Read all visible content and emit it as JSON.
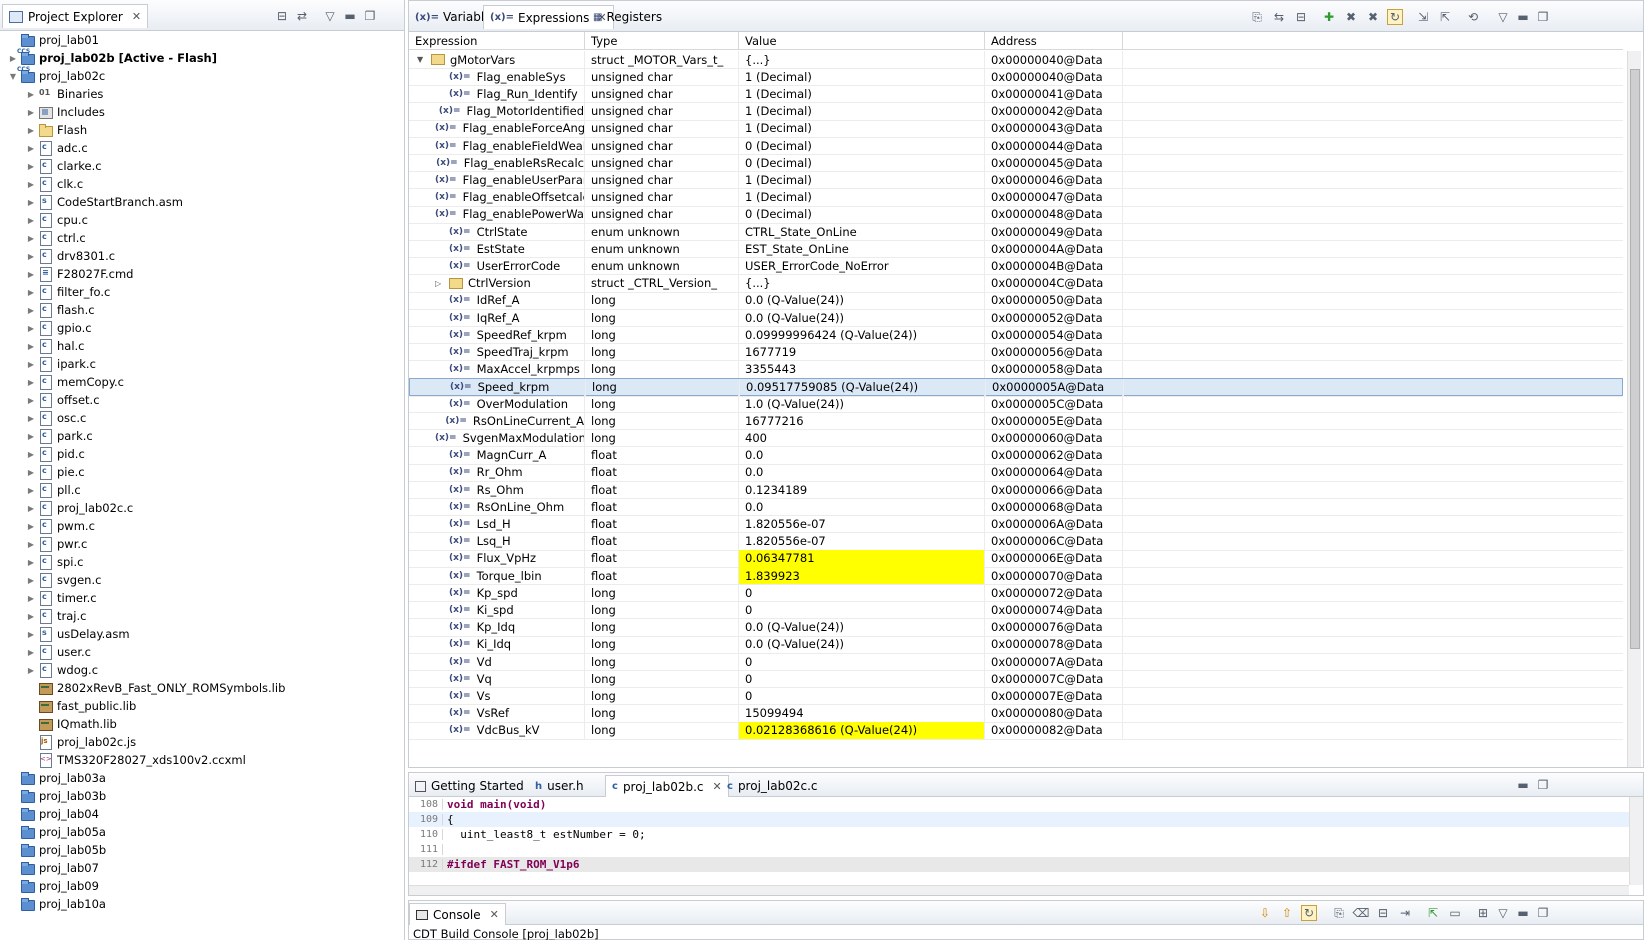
{
  "explorer": {
    "title": "Project Explorer",
    "items": [
      {
        "label": "proj_lab01",
        "kind": "project",
        "indent": 0,
        "arrow": ""
      },
      {
        "label": "proj_lab02b  [Active - Flash]",
        "kind": "ccs-project",
        "indent": 0,
        "arrow": "▶",
        "bold": true
      },
      {
        "label": "proj_lab02c",
        "kind": "ccs-project",
        "indent": 0,
        "arrow": "▼"
      },
      {
        "label": "Binaries",
        "kind": "bin",
        "indent": 1,
        "arrow": "▶"
      },
      {
        "label": "Includes",
        "kind": "inc",
        "indent": 1,
        "arrow": "▶"
      },
      {
        "label": "Flash",
        "kind": "folder",
        "indent": 1,
        "arrow": "▶"
      },
      {
        "label": "adc.c",
        "kind": "file",
        "indent": 1,
        "arrow": "▶"
      },
      {
        "label": "clarke.c",
        "kind": "file",
        "indent": 1,
        "arrow": "▶"
      },
      {
        "label": "clk.c",
        "kind": "file",
        "indent": 1,
        "arrow": "▶"
      },
      {
        "label": "CodeStartBranch.asm",
        "kind": "asm",
        "indent": 1,
        "arrow": "▶"
      },
      {
        "label": "cpu.c",
        "kind": "file",
        "indent": 1,
        "arrow": "▶"
      },
      {
        "label": "ctrl.c",
        "kind": "file",
        "indent": 1,
        "arrow": "▶"
      },
      {
        "label": "drv8301.c",
        "kind": "file",
        "indent": 1,
        "arrow": "▶"
      },
      {
        "label": "F28027F.cmd",
        "kind": "cmd",
        "indent": 1,
        "arrow": "▶"
      },
      {
        "label": "filter_fo.c",
        "kind": "file",
        "indent": 1,
        "arrow": "▶"
      },
      {
        "label": "flash.c",
        "kind": "file",
        "indent": 1,
        "arrow": "▶"
      },
      {
        "label": "gpio.c",
        "kind": "file",
        "indent": 1,
        "arrow": "▶"
      },
      {
        "label": "hal.c",
        "kind": "file",
        "indent": 1,
        "arrow": "▶"
      },
      {
        "label": "ipark.c",
        "kind": "file",
        "indent": 1,
        "arrow": "▶"
      },
      {
        "label": "memCopy.c",
        "kind": "file",
        "indent": 1,
        "arrow": "▶"
      },
      {
        "label": "offset.c",
        "kind": "file",
        "indent": 1,
        "arrow": "▶"
      },
      {
        "label": "osc.c",
        "kind": "file",
        "indent": 1,
        "arrow": "▶"
      },
      {
        "label": "park.c",
        "kind": "file",
        "indent": 1,
        "arrow": "▶"
      },
      {
        "label": "pid.c",
        "kind": "file",
        "indent": 1,
        "arrow": "▶"
      },
      {
        "label": "pie.c",
        "kind": "file",
        "indent": 1,
        "arrow": "▶"
      },
      {
        "label": "pll.c",
        "kind": "file",
        "indent": 1,
        "arrow": "▶"
      },
      {
        "label": "proj_lab02c.c",
        "kind": "file",
        "indent": 1,
        "arrow": "▶"
      },
      {
        "label": "pwm.c",
        "kind": "file",
        "indent": 1,
        "arrow": "▶"
      },
      {
        "label": "pwr.c",
        "kind": "file",
        "indent": 1,
        "arrow": "▶"
      },
      {
        "label": "spi.c",
        "kind": "file",
        "indent": 1,
        "arrow": "▶"
      },
      {
        "label": "svgen.c",
        "kind": "file",
        "indent": 1,
        "arrow": "▶"
      },
      {
        "label": "timer.c",
        "kind": "file",
        "indent": 1,
        "arrow": "▶"
      },
      {
        "label": "traj.c",
        "kind": "file",
        "indent": 1,
        "arrow": "▶"
      },
      {
        "label": "usDelay.asm",
        "kind": "asm",
        "indent": 1,
        "arrow": "▶"
      },
      {
        "label": "user.c",
        "kind": "file",
        "indent": 1,
        "arrow": "▶"
      },
      {
        "label": "wdog.c",
        "kind": "file",
        "indent": 1,
        "arrow": "▶"
      },
      {
        "label": "2802xRevB_Fast_ONLY_ROMSymbols.lib",
        "kind": "lib",
        "indent": 1,
        "arrow": ""
      },
      {
        "label": "fast_public.lib",
        "kind": "lib",
        "indent": 1,
        "arrow": ""
      },
      {
        "label": "IQmath.lib",
        "kind": "lib",
        "indent": 1,
        "arrow": ""
      },
      {
        "label": "proj_lab02c.js",
        "kind": "js",
        "indent": 1,
        "arrow": ""
      },
      {
        "label": "TMS320F28027_xds100v2.ccxml",
        "kind": "xml",
        "indent": 1,
        "arrow": ""
      },
      {
        "label": "proj_lab03a",
        "kind": "project",
        "indent": 0,
        "arrow": ""
      },
      {
        "label": "proj_lab03b",
        "kind": "project",
        "indent": 0,
        "arrow": ""
      },
      {
        "label": "proj_lab04",
        "kind": "project",
        "indent": 0,
        "arrow": ""
      },
      {
        "label": "proj_lab05a",
        "kind": "project",
        "indent": 0,
        "arrow": ""
      },
      {
        "label": "proj_lab05b",
        "kind": "project",
        "indent": 0,
        "arrow": ""
      },
      {
        "label": "proj_lab07",
        "kind": "project",
        "indent": 0,
        "arrow": ""
      },
      {
        "label": "proj_lab09",
        "kind": "project",
        "indent": 0,
        "arrow": ""
      },
      {
        "label": "proj_lab10a",
        "kind": "project",
        "indent": 0,
        "arrow": ""
      }
    ]
  },
  "expressions": {
    "tabs": [
      {
        "label": "Variables",
        "icon": "(x)="
      },
      {
        "label": "Expressions",
        "icon": "(x)="
      },
      {
        "label": "Registers",
        "icon": "▦"
      }
    ],
    "columns": [
      "Expression",
      "Type",
      "Value",
      "Address"
    ],
    "rows": [
      {
        "name": "gMotorVars",
        "type": "struct _MOTOR_Vars_t_",
        "value": "{...}",
        "address": "0x00000040@Data",
        "level": 0,
        "icon": "struct",
        "arrow": "▼"
      },
      {
        "name": "Flag_enableSys",
        "type": "unsigned char",
        "value": "1 (Decimal)",
        "address": "0x00000040@Data",
        "level": 1,
        "icon": "var"
      },
      {
        "name": "Flag_Run_Identify",
        "type": "unsigned char",
        "value": "1 (Decimal)",
        "address": "0x00000041@Data",
        "level": 1,
        "icon": "var"
      },
      {
        "name": "Flag_MotorIdentified",
        "type": "unsigned char",
        "value": "1 (Decimal)",
        "address": "0x00000042@Data",
        "level": 1,
        "icon": "var"
      },
      {
        "name": "Flag_enableForceAng",
        "type": "unsigned char",
        "value": "1 (Decimal)",
        "address": "0x00000043@Data",
        "level": 1,
        "icon": "var"
      },
      {
        "name": "Flag_enableFieldWeak",
        "type": "unsigned char",
        "value": "0 (Decimal)",
        "address": "0x00000044@Data",
        "level": 1,
        "icon": "var"
      },
      {
        "name": "Flag_enableRsRecalc",
        "type": "unsigned char",
        "value": "0 (Decimal)",
        "address": "0x00000045@Data",
        "level": 1,
        "icon": "var"
      },
      {
        "name": "Flag_enableUserParam",
        "type": "unsigned char",
        "value": "1 (Decimal)",
        "address": "0x00000046@Data",
        "level": 1,
        "icon": "var"
      },
      {
        "name": "Flag_enableOffsetcalc",
        "type": "unsigned char",
        "value": "1 (Decimal)",
        "address": "0x00000047@Data",
        "level": 1,
        "icon": "var"
      },
      {
        "name": "Flag_enablePowerWar",
        "type": "unsigned char",
        "value": "0 (Decimal)",
        "address": "0x00000048@Data",
        "level": 1,
        "icon": "var"
      },
      {
        "name": "CtrlState",
        "type": "enum unknown",
        "value": "CTRL_State_OnLine",
        "address": "0x00000049@Data",
        "level": 1,
        "icon": "var"
      },
      {
        "name": "EstState",
        "type": "enum unknown",
        "value": "EST_State_OnLine",
        "address": "0x0000004A@Data",
        "level": 1,
        "icon": "var"
      },
      {
        "name": "UserErrorCode",
        "type": "enum unknown",
        "value": "USER_ErrorCode_NoError",
        "address": "0x0000004B@Data",
        "level": 1,
        "icon": "var"
      },
      {
        "name": "CtrlVersion",
        "type": "struct _CTRL_Version_",
        "value": "{...}",
        "address": "0x0000004C@Data",
        "level": 1,
        "icon": "struct",
        "arrow": "▷"
      },
      {
        "name": "IdRef_A",
        "type": "long",
        "value": "0.0 (Q-Value(24))",
        "address": "0x00000050@Data",
        "level": 1,
        "icon": "var"
      },
      {
        "name": "IqRef_A",
        "type": "long",
        "value": "0.0 (Q-Value(24))",
        "address": "0x00000052@Data",
        "level": 1,
        "icon": "var"
      },
      {
        "name": "SpeedRef_krpm",
        "type": "long",
        "value": "0.09999996424 (Q-Value(24))",
        "address": "0x00000054@Data",
        "level": 1,
        "icon": "var"
      },
      {
        "name": "SpeedTraj_krpm",
        "type": "long",
        "value": "1677719",
        "address": "0x00000056@Data",
        "level": 1,
        "icon": "var"
      },
      {
        "name": "MaxAccel_krpmps",
        "type": "long",
        "value": "3355443",
        "address": "0x00000058@Data",
        "level": 1,
        "icon": "var"
      },
      {
        "name": "Speed_krpm",
        "type": "long",
        "value": "0.09517759085 (Q-Value(24))",
        "address": "0x0000005A@Data",
        "level": 1,
        "icon": "var",
        "selected": true
      },
      {
        "name": "OverModulation",
        "type": "long",
        "value": "1.0 (Q-Value(24))",
        "address": "0x0000005C@Data",
        "level": 1,
        "icon": "var"
      },
      {
        "name": "RsOnLineCurrent_A",
        "type": "long",
        "value": "16777216",
        "address": "0x0000005E@Data",
        "level": 1,
        "icon": "var"
      },
      {
        "name": "SvgenMaxModulation",
        "type": "long",
        "value": "400",
        "address": "0x00000060@Data",
        "level": 1,
        "icon": "var"
      },
      {
        "name": "MagnCurr_A",
        "type": "float",
        "value": "0.0",
        "address": "0x00000062@Data",
        "level": 1,
        "icon": "var"
      },
      {
        "name": "Rr_Ohm",
        "type": "float",
        "value": "0.0",
        "address": "0x00000064@Data",
        "level": 1,
        "icon": "var"
      },
      {
        "name": "Rs_Ohm",
        "type": "float",
        "value": "0.1234189",
        "address": "0x00000066@Data",
        "level": 1,
        "icon": "var"
      },
      {
        "name": "RsOnLine_Ohm",
        "type": "float",
        "value": "0.0",
        "address": "0x00000068@Data",
        "level": 1,
        "icon": "var"
      },
      {
        "name": "Lsd_H",
        "type": "float",
        "value": "1.820556e-07",
        "address": "0x0000006A@Data",
        "level": 1,
        "icon": "var"
      },
      {
        "name": "Lsq_H",
        "type": "float",
        "value": "1.820556e-07",
        "address": "0x0000006C@Data",
        "level": 1,
        "icon": "var"
      },
      {
        "name": "Flux_VpHz",
        "type": "float",
        "value": "0.06347781",
        "address": "0x0000006E@Data",
        "level": 1,
        "icon": "var",
        "highlight": true
      },
      {
        "name": "Torque_lbin",
        "type": "float",
        "value": "1.839923",
        "address": "0x00000070@Data",
        "level": 1,
        "icon": "var",
        "highlight": true
      },
      {
        "name": "Kp_spd",
        "type": "long",
        "value": "0",
        "address": "0x00000072@Data",
        "level": 1,
        "icon": "var"
      },
      {
        "name": "Ki_spd",
        "type": "long",
        "value": "0",
        "address": "0x00000074@Data",
        "level": 1,
        "icon": "var"
      },
      {
        "name": "Kp_Idq",
        "type": "long",
        "value": "0.0 (Q-Value(24))",
        "address": "0x00000076@Data",
        "level": 1,
        "icon": "var"
      },
      {
        "name": "Ki_Idq",
        "type": "long",
        "value": "0.0 (Q-Value(24))",
        "address": "0x00000078@Data",
        "level": 1,
        "icon": "var"
      },
      {
        "name": "Vd",
        "type": "long",
        "value": "0",
        "address": "0x0000007A@Data",
        "level": 1,
        "icon": "var"
      },
      {
        "name": "Vq",
        "type": "long",
        "value": "0",
        "address": "0x0000007C@Data",
        "level": 1,
        "icon": "var"
      },
      {
        "name": "Vs",
        "type": "long",
        "value": "0",
        "address": "0x0000007E@Data",
        "level": 1,
        "icon": "var"
      },
      {
        "name": "VsRef",
        "type": "long",
        "value": "15099494",
        "address": "0x00000080@Data",
        "level": 1,
        "icon": "var"
      },
      {
        "name": "VdcBus_kV",
        "type": "long",
        "value": "0.02128368616 (Q-Value(24))",
        "address": "0x00000082@Data",
        "level": 1,
        "icon": "var",
        "highlight": true
      }
    ]
  },
  "editor": {
    "tabs": [
      {
        "label": "Getting Started",
        "active": false
      },
      {
        "label": "user.h",
        "active": false
      },
      {
        "label": "proj_lab02b.c",
        "active": true
      },
      {
        "label": "proj_lab02c.c",
        "active": false
      }
    ],
    "lines": [
      {
        "num": "108",
        "text": "void main(void)"
      },
      {
        "num": "109",
        "text": "{"
      },
      {
        "num": "110",
        "text": "  uint_least8_t estNumber = 0;"
      },
      {
        "num": "111",
        "text": ""
      },
      {
        "num": "112",
        "text": "#ifdef FAST_ROM_V1p6"
      }
    ]
  },
  "console": {
    "tab": "Console",
    "title": "CDT Build Console [proj_lab02b]"
  }
}
